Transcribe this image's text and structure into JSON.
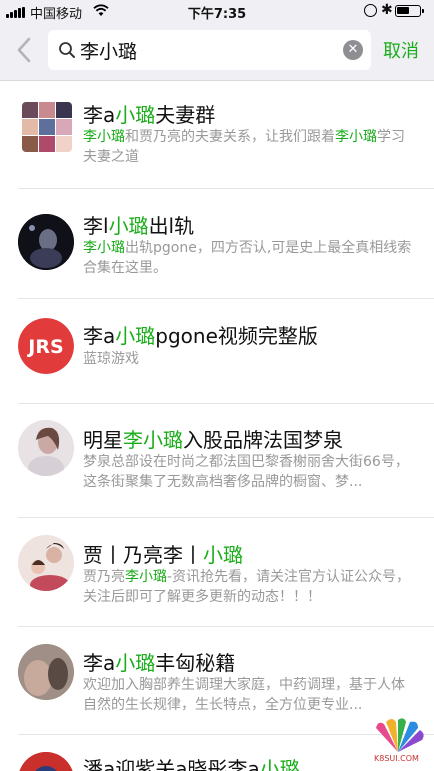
{
  "status_bar": {
    "carrier": "中国移动",
    "time": "下午7:35"
  },
  "search": {
    "query": "李小璐",
    "cancel_label": "取消"
  },
  "results": [
    {
      "title": [
        [
          "李a",
          false
        ],
        [
          "小璐",
          true
        ],
        [
          "夫妻群",
          false
        ]
      ],
      "desc": [
        [
          "李小璐",
          true
        ],
        [
          "和贾乃亮的夫妻关系，让我们跟着",
          false
        ],
        [
          "李小璐",
          true
        ],
        [
          "学习夫妻之道",
          false
        ]
      ]
    },
    {
      "title": [
        [
          "李l",
          false
        ],
        [
          "小璐",
          true
        ],
        [
          "出l轨",
          false
        ]
      ],
      "desc": [
        [
          "李小璐",
          true
        ],
        [
          "出轨pgone，四方否认,可是史上最全真相线索合集在这里。",
          false
        ]
      ]
    },
    {
      "title": [
        [
          "李a",
          false
        ],
        [
          "小璐",
          true
        ],
        [
          "pgone视频完整版",
          false
        ]
      ],
      "desc": [
        [
          "蓝琼游戏",
          false
        ]
      ],
      "logo_text": "JRS",
      "logo_color": "#e23b3b"
    },
    {
      "title": [
        [
          "明星",
          false
        ],
        [
          "李小璐",
          true
        ],
        [
          "入股品牌法国梦泉",
          false
        ]
      ],
      "desc": [
        [
          "梦泉总部设在时尚之都法国巴黎香榭丽舍大街66号，这条街聚集了无数高档奢侈品牌的橱窗、梦...",
          false
        ]
      ]
    },
    {
      "title": [
        [
          "贾丨乃亮李丨",
          false
        ],
        [
          "小璐",
          true
        ]
      ],
      "desc": [
        [
          "贾乃亮",
          false
        ],
        [
          "李小璐",
          true
        ],
        [
          "-资讯抢先看，请关注官方认证公众号，关注后即可了解更多更新的动态！！！",
          false
        ]
      ]
    },
    {
      "title": [
        [
          "李a",
          false
        ],
        [
          "小璐",
          true
        ],
        [
          "丰匈秘籍",
          false
        ]
      ],
      "desc": [
        [
          "欢迎加入胸部养生调理大家庭，中药调理，基于人体自然的生长规律，生长特点，全方位更专业...",
          false
        ]
      ]
    },
    {
      "title": [
        [
          "潘a迎紫关a晓彤李a",
          false
        ],
        [
          "小璐",
          true
        ]
      ],
      "desc": []
    }
  ],
  "watermark": "K8SUI.COM",
  "colors": {
    "accent": "#1aad19",
    "header_bg": "#efeff4",
    "secondary_text": "#999999"
  }
}
